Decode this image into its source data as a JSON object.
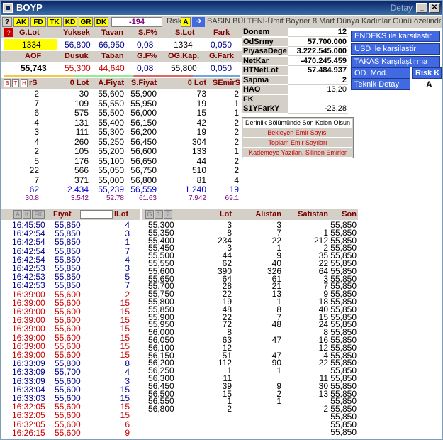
{
  "window": {
    "title": "BOYP",
    "title_right": "Detay"
  },
  "toolbar": {
    "tags": [
      "AK",
      "FD",
      "TK",
      "KD",
      "GR",
      "DK"
    ],
    "value": "-194",
    "risk_label": "Risk",
    "risk_grade": "A",
    "ticker": "BASIN BÜLTENİ-Ümit Boyner 8 Mart Dünya Kadınlar Günü özelinde bi"
  },
  "summary1": {
    "headers": [
      "G.Lot",
      "Yuksek",
      "Tavan",
      "S.F%",
      "S.Lot",
      "Fark"
    ],
    "values": [
      "1334",
      "56,800",
      "66,950",
      "0,08",
      "1334",
      "0,050"
    ]
  },
  "summary2": {
    "headers": [
      "AOF",
      "Dusuk",
      "Taban",
      "G.F%",
      "OG.Kap.",
      "G.Fark"
    ],
    "values": [
      "55,743",
      "55,300",
      "44,640",
      "0,08",
      "55,800",
      "0,050"
    ]
  },
  "fundamentals": [
    {
      "label": "Donem",
      "value": "12"
    },
    {
      "label": "OdSrmy",
      "value": "57.700.000"
    },
    {
      "label": "PiyasaDege",
      "value": "3.222.545.000"
    },
    {
      "label": "NetKar",
      "value": "-470.245.459"
    },
    {
      "label": "HTNetLot",
      "value": "57.484.937"
    },
    {
      "label": "Sapma",
      "value": "2"
    },
    {
      "label": "HAO",
      "value": "13,20"
    },
    {
      "label": "FK",
      "value": ""
    },
    {
      "label": "S1YFarkY",
      "value": "-23,28"
    }
  ],
  "buttons": {
    "endeks": "ENDEKS ile karsilastir",
    "usd": "USD ile karsilastir",
    "takas": "TAKAS Karşılaştırma",
    "od_mod": "OD. Mod.",
    "risk_k": "Risk K",
    "teknik": "Teknik Detay",
    "teknik_grade": "A"
  },
  "context_menu": [
    "Derinlik Bölümünde Son Kolon Olsun",
    "Bekleyen Emir Sayısı",
    "Toplam Emir Sayıları",
    "Kademeye Yazılan, Silinen Emirler"
  ],
  "depth": {
    "tabs": [
      "B",
      "T",
      "H"
    ],
    "headers": [
      "rS",
      "0 Lot",
      "A.Fiyat",
      "S.Fiyat",
      "0 Lot",
      "SEmirS"
    ],
    "rows": [
      [
        "2",
        "30",
        "55,600",
        "55,900",
        "73",
        "2"
      ],
      [
        "7",
        "109",
        "55,550",
        "55,950",
        "19",
        "1"
      ],
      [
        "6",
        "575",
        "55,500",
        "56,000",
        "15",
        "1"
      ],
      [
        "4",
        "131",
        "55,400",
        "56,150",
        "42",
        "2"
      ],
      [
        "3",
        "111",
        "55,300",
        "56,200",
        "19",
        "2"
      ],
      [
        "4",
        "260",
        "55,250",
        "56,450",
        "304",
        "2"
      ],
      [
        "2",
        "105",
        "55,200",
        "56,600",
        "133",
        "1"
      ],
      [
        "5",
        "176",
        "55,100",
        "56,650",
        "44",
        "2"
      ],
      [
        "22",
        "566",
        "55,050",
        "56,750",
        "510",
        "2"
      ],
      [
        "7",
        "371",
        "55,000",
        "56,800",
        "81",
        "4"
      ]
    ],
    "totals": [
      "62",
      "2.434",
      "55,239",
      "56,559",
      "1.240",
      "19"
    ],
    "avgs": [
      "30.8",
      "3.542",
      "52.78",
      "61.63",
      "7.942",
      "69.1"
    ]
  },
  "trades": {
    "tabs": [
      "A",
      "K",
      "FK"
    ],
    "headers": [
      "Fiyat",
      "ILot"
    ],
    "rows": [
      {
        "time": "16:45:50",
        "price": "55,850",
        "lot": "4",
        "side": "buy"
      },
      {
        "time": "16:42:54",
        "price": "55,850",
        "lot": "3",
        "side": "buy"
      },
      {
        "time": "16:42:54",
        "price": "55,850",
        "lot": "1",
        "side": "buy"
      },
      {
        "time": "16:42:54",
        "price": "55,850",
        "lot": "7",
        "side": "buy"
      },
      {
        "time": "16:42:54",
        "price": "55,850",
        "lot": "4",
        "side": "buy"
      },
      {
        "time": "16:42:53",
        "price": "55,850",
        "lot": "3",
        "side": "buy"
      },
      {
        "time": "16:42:53",
        "price": "55,850",
        "lot": "5",
        "side": "buy"
      },
      {
        "time": "16:42:53",
        "price": "55,850",
        "lot": "7",
        "side": "buy"
      },
      {
        "time": "16:39:00",
        "price": "55,600",
        "lot": "2",
        "side": "sell"
      },
      {
        "time": "16:39:00",
        "price": "55,600",
        "lot": "15",
        "side": "sell"
      },
      {
        "time": "16:39:00",
        "price": "55,600",
        "lot": "15",
        "side": "sell"
      },
      {
        "time": "16:39:00",
        "price": "55,600",
        "lot": "15",
        "side": "sell"
      },
      {
        "time": "16:39:00",
        "price": "55,600",
        "lot": "15",
        "side": "sell"
      },
      {
        "time": "16:39:00",
        "price": "55,600",
        "lot": "15",
        "side": "sell"
      },
      {
        "time": "16:39:00",
        "price": "55,600",
        "lot": "15",
        "side": "sell"
      },
      {
        "time": "16:39:00",
        "price": "55,600",
        "lot": "15",
        "side": "sell"
      },
      {
        "time": "16:33:09",
        "price": "55,800",
        "lot": "8",
        "side": "buy"
      },
      {
        "time": "16:33:09",
        "price": "55,700",
        "lot": "4",
        "side": "buy"
      },
      {
        "time": "16:33:09",
        "price": "55,600",
        "lot": "3",
        "side": "buy"
      },
      {
        "time": "16:33:04",
        "price": "55,600",
        "lot": "15",
        "side": "buy"
      },
      {
        "time": "16:33:03",
        "price": "55,600",
        "lot": "15",
        "side": "buy"
      },
      {
        "time": "16:32:05",
        "price": "55,600",
        "lot": "15",
        "side": "sell"
      },
      {
        "time": "16:32:05",
        "price": "55,600",
        "lot": "15",
        "side": "sell"
      },
      {
        "time": "16:32:05",
        "price": "55,600",
        "lot": "6",
        "side": "sell"
      },
      {
        "time": "16:26:15",
        "price": "55,600",
        "lot": "9",
        "side": "sell"
      }
    ]
  },
  "volume": {
    "tabs": [
      "G",
      "1",
      "2"
    ],
    "headers": [
      "Lot",
      "Alistan",
      "Satistan",
      "Son"
    ],
    "rows": [
      [
        "55,300",
        "3",
        "3",
        "",
        "55,850"
      ],
      [
        "55,350",
        "8",
        "7",
        "1",
        "55,850"
      ],
      [
        "55,400",
        "234",
        "22",
        "212",
        "55,850"
      ],
      [
        "55,450",
        "3",
        "1",
        "2",
        "55,850"
      ],
      [
        "55,500",
        "44",
        "9",
        "35",
        "55,850"
      ],
      [
        "55,550",
        "62",
        "40",
        "22",
        "55,850"
      ],
      [
        "55,600",
        "390",
        "326",
        "64",
        "55,850"
      ],
      [
        "55,650",
        "64",
        "61",
        "3",
        "55,850"
      ],
      [
        "55,700",
        "28",
        "21",
        "7",
        "55,850"
      ],
      [
        "55,750",
        "22",
        "13",
        "9",
        "55,850"
      ],
      [
        "55,800",
        "19",
        "1",
        "18",
        "55,850"
      ],
      [
        "55,850",
        "48",
        "8",
        "40",
        "55,850"
      ],
      [
        "55,900",
        "22",
        "7",
        "15",
        "55,850"
      ],
      [
        "55,950",
        "72",
        "48",
        "24",
        "55,850"
      ],
      [
        "56,000",
        "8",
        "",
        "8",
        "55,850"
      ],
      [
        "56,050",
        "63",
        "47",
        "16",
        "55,850"
      ],
      [
        "56,100",
        "12",
        "",
        "12",
        "55,850"
      ],
      [
        "56,150",
        "51",
        "47",
        "4",
        "55,850"
      ],
      [
        "56,200",
        "112",
        "90",
        "22",
        "55,850"
      ],
      [
        "56,250",
        "1",
        "1",
        "",
        "55,850"
      ],
      [
        "56,300",
        "11",
        "",
        "11",
        "55,850"
      ],
      [
        "56,450",
        "39",
        "9",
        "30",
        "55,850"
      ],
      [
        "56,500",
        "15",
        "2",
        "13",
        "55,850"
      ],
      [
        "56,550",
        "1",
        "1",
        "",
        "55,850"
      ],
      [
        "56,800",
        "2",
        "",
        "2",
        "55,850"
      ],
      [
        "",
        "",
        "",
        "",
        "55,850"
      ],
      [
        "",
        "",
        "",
        "",
        "55,850"
      ],
      [
        "",
        "",
        "",
        "",
        "55,850"
      ]
    ]
  }
}
